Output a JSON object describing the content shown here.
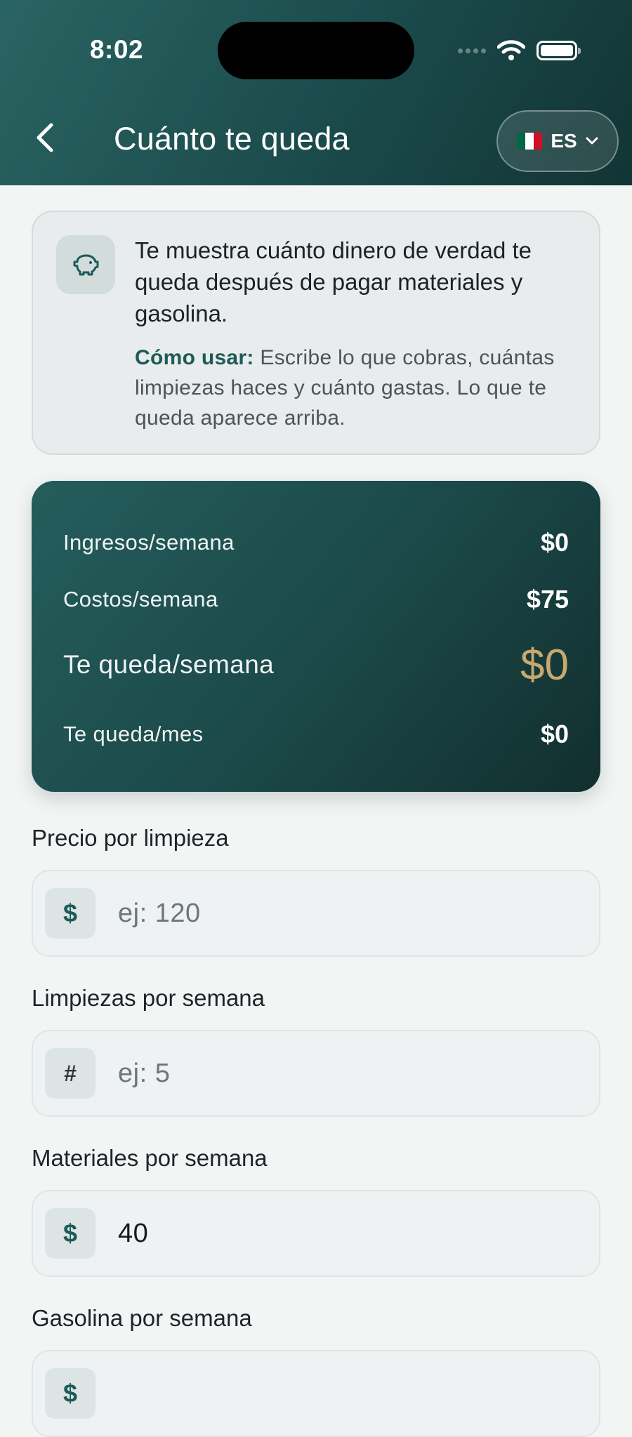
{
  "status_bar": {
    "time": "8:02"
  },
  "header": {
    "title": "Cuánto te queda",
    "language": "ES",
    "flag_colors": [
      "#006847",
      "#ffffff",
      "#ce1126"
    ]
  },
  "info": {
    "headline": "Te muestra cuánto dinero de verdad te queda después de pagar materiales y gasolina.",
    "howto_label": "Cómo usar:",
    "howto_text": " Escribe lo que cobras, cuántas limpiezas haces y cuánto gastas. Lo que te queda aparece arriba.",
    "icon": "piggy-bank-icon"
  },
  "summary": {
    "rows": [
      {
        "label": "Ingresos/semana",
        "value": "$0"
      },
      {
        "label": "Costos/semana",
        "value": "$75"
      },
      {
        "label": "Te queda/semana",
        "value": "$0"
      },
      {
        "label": "Te queda/mes",
        "value": "$0"
      }
    ]
  },
  "fields": [
    {
      "label": "Precio por limpieza",
      "prefix": "$",
      "value": "",
      "placeholder": "ej: 120"
    },
    {
      "label": "Limpiezas por semana",
      "prefix": "#",
      "value": "",
      "placeholder": "ej: 5"
    },
    {
      "label": "Materiales por semana",
      "prefix": "$",
      "value": "40",
      "placeholder": ""
    },
    {
      "label": "Gasolina por semana",
      "prefix": "$",
      "value": "",
      "placeholder": ""
    }
  ],
  "colors": {
    "header_start": "#2a6462",
    "header_end": "#123434",
    "accent_gold": "#c8a86e",
    "accent_teal": "#1d5a58"
  }
}
